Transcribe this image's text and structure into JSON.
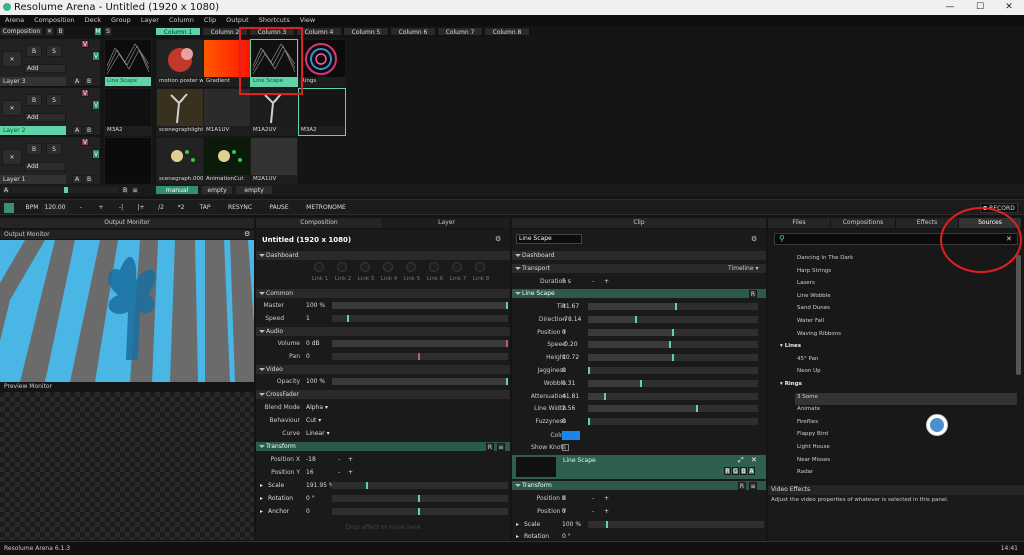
{
  "window": {
    "title": "Resolume Arena - Untitled (1920 x 1080)",
    "minimize": "—",
    "maximize": "☐",
    "close": "✕"
  },
  "menu": [
    "Arena",
    "Composition",
    "Deck",
    "Group",
    "Layer",
    "Column",
    "Clip",
    "Output",
    "Shortcuts",
    "View"
  ],
  "composition_label": "Composition",
  "columns": [
    "Column 1",
    "Column 2",
    "Column 3",
    "Column 4",
    "Column 5",
    "Column 6",
    "Column 7",
    "Column 8"
  ],
  "layers": [
    {
      "name": "Layer 3",
      "blend": "Add",
      "clips": [
        "Line Scape",
        "motion poster wit...",
        "Gradient",
        "Line Scape",
        "Rings"
      ]
    },
    {
      "name": "Layer 2",
      "blend": "Add",
      "clips": [
        "M3A2",
        "scenegraphlight",
        "M1A1UV",
        "M1A2UV",
        "M3A2"
      ]
    },
    {
      "name": "Layer 1",
      "blend": "Add",
      "clips": [
        "",
        "scenegraph.0000",
        "AnimationCut",
        "M2A1UV"
      ]
    }
  ],
  "deck_tabs": [
    "manual",
    "empty",
    "empty"
  ],
  "transport": {
    "bpm_label": "BPM",
    "bpm": "120.00",
    "minus": "-",
    "plus": "+",
    "prev": "-|",
    "next": "|+",
    "half": "/2",
    "double": "*2",
    "tap": "TAP",
    "resync": "RESYNC",
    "pause": "PAUSE",
    "metronome": "METRONOME",
    "record": "RECORD"
  },
  "panels": {
    "output": "Output Monitor",
    "composition": "Composition",
    "layer": "Layer",
    "clip": "Clip",
    "files": "Files",
    "compositions": "Compositions",
    "effects": "Effects",
    "sources": "Sources"
  },
  "monitors": {
    "output": "Output Monitor",
    "preview": "Preview Monitor"
  },
  "composition": {
    "title": "Untitled (1920 x 1080)",
    "dashboard": "Dashboard",
    "links": [
      "Link 1",
      "Link 2",
      "Link 3",
      "Link 4",
      "Link 5",
      "Link 6",
      "Link 7",
      "Link 8"
    ],
    "common": "Common",
    "master_label": "Master",
    "master": "100 %",
    "speed_label": "Speed",
    "speed": "1",
    "audio": "Audio",
    "volume_label": "Volume",
    "volume": "0 dB",
    "pan_label": "Pan",
    "pan": "0",
    "video": "Video",
    "opacity_label": "Opacity",
    "opacity": "100 %",
    "crossfader": "CrossFader",
    "blend_label": "Blend Mode",
    "blend": "Alpha",
    "behaviour_label": "Behaviour",
    "behaviour": "Cut",
    "curve_label": "Curve",
    "curve": "Linear",
    "transform": "Transform",
    "posx_label": "Position X",
    "posx": "-18",
    "posy_label": "Position Y",
    "posy": "16",
    "scale_label": "Scale",
    "scale": "191.95 %",
    "rotation_label": "Rotation",
    "rotation": "0 °",
    "anchor_label": "Anchor",
    "anchor": "0",
    "drop_hint": "Drop effect or mask here"
  },
  "clip": {
    "name": "Line Scape",
    "dashboard": "Dashboard",
    "transport": "Transport",
    "transport_mode": "Timeline",
    "duration_label": "Duration",
    "duration": "5 s",
    "section": "Line Scape",
    "params": [
      {
        "label": "Tilt",
        "value": "41.67",
        "pos": 0.52
      },
      {
        "label": "Direction",
        "value": "-78.14",
        "pos": 0.28
      },
      {
        "label": "Position Y",
        "value": "0",
        "pos": 0.5
      },
      {
        "label": "Speed",
        "value": "-0.20",
        "pos": 0.48
      },
      {
        "label": "Height",
        "value": "10.72",
        "pos": 0.5
      },
      {
        "label": "Jagginess",
        "value": "0",
        "pos": 0.0
      },
      {
        "label": "Wobble",
        "value": "0.31",
        "pos": 0.31
      },
      {
        "label": "Attenuation",
        "value": "41.81",
        "pos": 0.1
      },
      {
        "label": "Line Width",
        "value": "2.56",
        "pos": 0.64
      },
      {
        "label": "Fuzzyness",
        "value": "0",
        "pos": 0.0
      }
    ],
    "color_label": "Color",
    "color": "#1a86e6",
    "show_knots_label": "Show Knots",
    "preview_name": "Line Scape",
    "rgba": [
      "R",
      "G",
      "B",
      "A"
    ],
    "transform": "Transform",
    "posx_label": "Position X",
    "posx": "0",
    "posy_label": "Position Y",
    "posy": "0",
    "scale_label": "Scale",
    "scale": "100 %",
    "rotation_label": "Rotation",
    "rotation": "0 °"
  },
  "sources": {
    "search_placeholder": "",
    "items": [
      {
        "type": "item",
        "label": "Dancing In The Dark"
      },
      {
        "type": "item",
        "label": "Harp Strings"
      },
      {
        "type": "item",
        "label": "Lasers"
      },
      {
        "type": "item",
        "label": "Line Wobble"
      },
      {
        "type": "item",
        "label": "Sand Dunes"
      },
      {
        "type": "item",
        "label": "Water Fall"
      },
      {
        "type": "item",
        "label": "Waving Ribbons"
      },
      {
        "type": "cat",
        "label": "Lines"
      },
      {
        "type": "item",
        "label": "45° Pan"
      },
      {
        "type": "item",
        "label": "Neon Up"
      },
      {
        "type": "cat",
        "label": "Rings"
      },
      {
        "type": "item",
        "label": "3 Some"
      },
      {
        "type": "item",
        "label": "Animate"
      },
      {
        "type": "item",
        "label": "Fireflies"
      },
      {
        "type": "item",
        "label": "Flappy Bird"
      },
      {
        "type": "item",
        "label": "Light House"
      },
      {
        "type": "item",
        "label": "Near Misses"
      },
      {
        "type": "item",
        "label": "Radar"
      }
    ]
  },
  "help": {
    "title": "Video Effects",
    "text": "Adjust the video properties of whatever is selected in this panel."
  },
  "status": {
    "version": "Resolume Arena 6.1.3",
    "time": "14:41"
  },
  "colors": {
    "accent": "#5fd3a9",
    "annotation": "#e02020"
  }
}
